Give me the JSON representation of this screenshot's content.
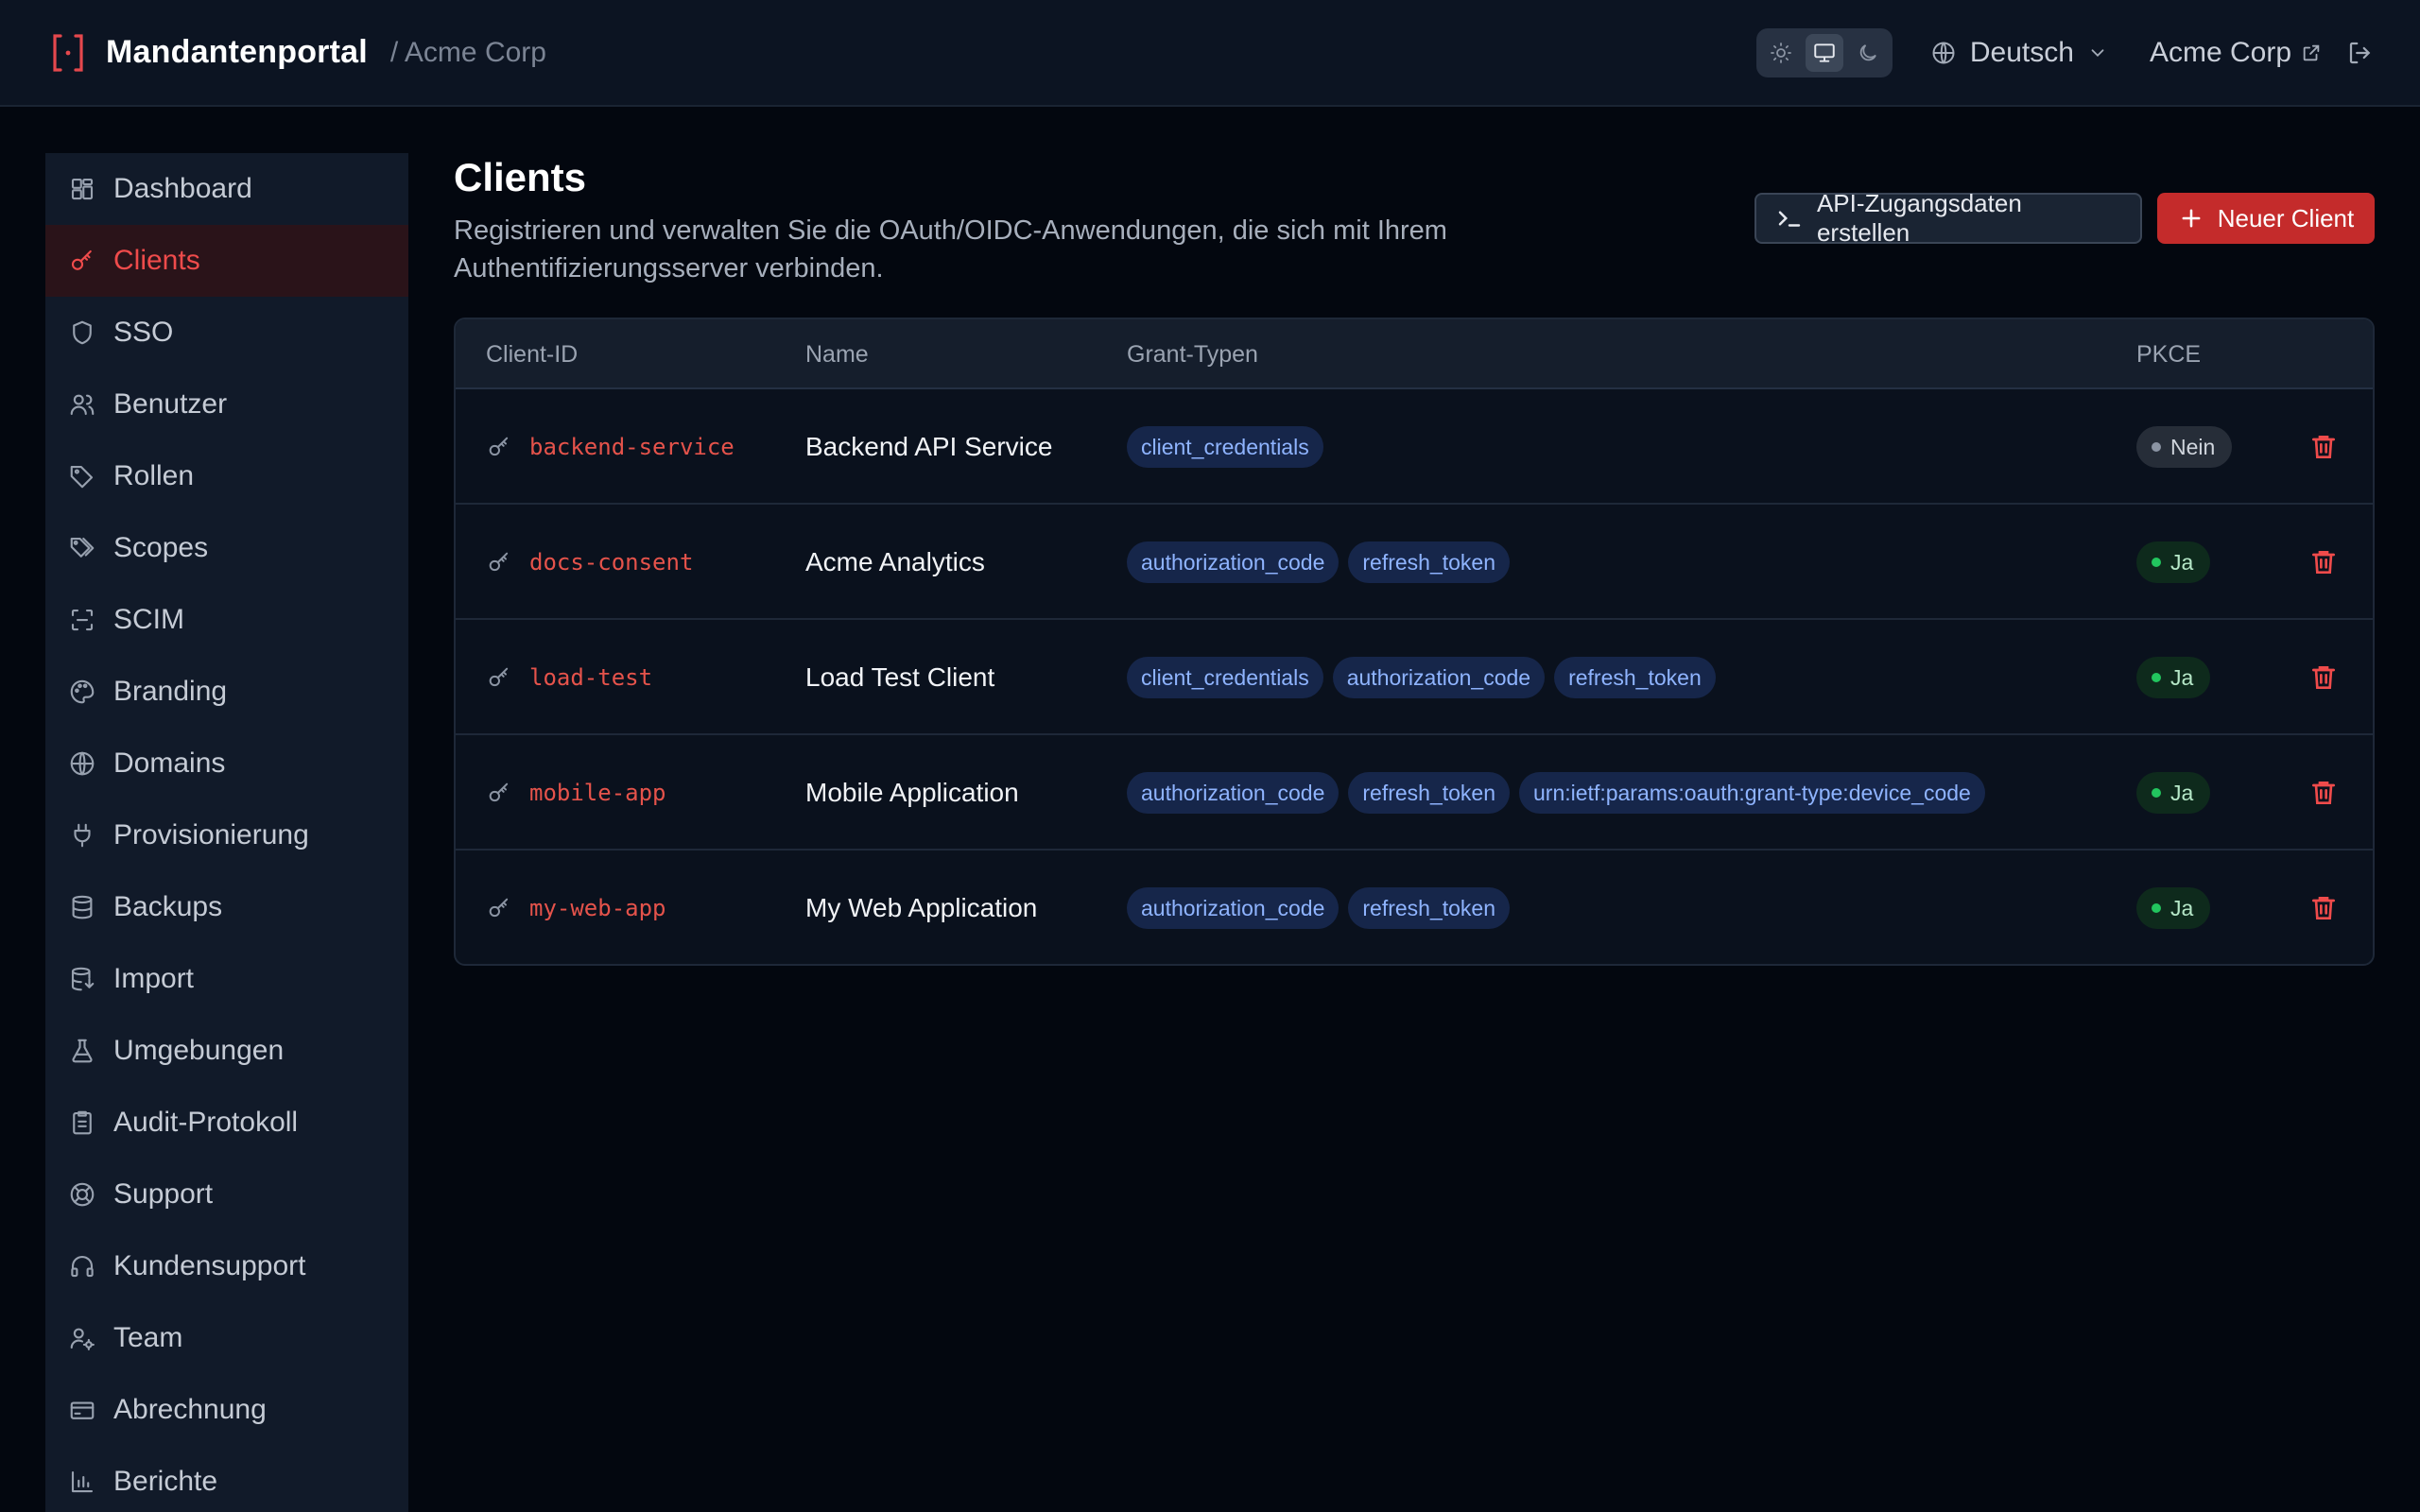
{
  "header": {
    "app_title": "Mandantenportal",
    "tenant_crumb": "/ Acme Corp",
    "language": "Deutsch",
    "tenant_link": "Acme Corp",
    "theme_active": "system"
  },
  "sidebar": {
    "items": [
      {
        "label": "Dashboard",
        "icon": "layout-dashboard-icon",
        "active": false
      },
      {
        "label": "Clients",
        "icon": "key-icon",
        "active": true
      },
      {
        "label": "SSO",
        "icon": "shield-icon",
        "active": false
      },
      {
        "label": "Benutzer",
        "icon": "users-icon",
        "active": false
      },
      {
        "label": "Rollen",
        "icon": "tag-icon",
        "active": false
      },
      {
        "label": "Scopes",
        "icon": "tags-icon",
        "active": false
      },
      {
        "label": "SCIM",
        "icon": "scan-icon",
        "active": false
      },
      {
        "label": "Branding",
        "icon": "palette-icon",
        "active": false
      },
      {
        "label": "Domains",
        "icon": "globe-icon",
        "active": false
      },
      {
        "label": "Provisionierung",
        "icon": "plug-icon",
        "active": false
      },
      {
        "label": "Backups",
        "icon": "database-icon",
        "active": false
      },
      {
        "label": "Import",
        "icon": "database-import-icon",
        "active": false
      },
      {
        "label": "Umgebungen",
        "icon": "flask-icon",
        "active": false
      },
      {
        "label": "Audit-Protokoll",
        "icon": "clipboard-icon",
        "active": false
      },
      {
        "label": "Support",
        "icon": "life-buoy-icon",
        "active": false
      },
      {
        "label": "Kundensupport",
        "icon": "headphones-icon",
        "active": false
      },
      {
        "label": "Team",
        "icon": "user-cog-icon",
        "active": false
      },
      {
        "label": "Abrechnung",
        "icon": "credit-card-icon",
        "active": false
      },
      {
        "label": "Berichte",
        "icon": "bar-chart-icon",
        "active": false
      }
    ]
  },
  "main": {
    "title": "Clients",
    "description": "Registrieren und verwalten Sie die OAuth/OIDC-Anwendungen, die sich mit Ihrem Authentifizierungsserver verbinden.",
    "api_button": "API-Zugangsdaten erstellen",
    "new_button": "Neuer Client"
  },
  "table": {
    "columns": [
      "Client-ID",
      "Name",
      "Grant-Typen",
      "PKCE"
    ],
    "rows": [
      {
        "client_id": "backend-service",
        "name": "Backend API Service",
        "grants": [
          "client_credentials"
        ],
        "pkce": "Nein",
        "pkce_enabled": false
      },
      {
        "client_id": "docs-consent",
        "name": "Acme Analytics",
        "grants": [
          "authorization_code",
          "refresh_token"
        ],
        "pkce": "Ja",
        "pkce_enabled": true
      },
      {
        "client_id": "load-test",
        "name": "Load Test Client",
        "grants": [
          "client_credentials",
          "authorization_code",
          "refresh_token"
        ],
        "pkce": "Ja",
        "pkce_enabled": true
      },
      {
        "client_id": "mobile-app",
        "name": "Mobile Application",
        "grants": [
          "authorization_code",
          "refresh_token",
          "urn:ietf:params:oauth:grant-type:device_code"
        ],
        "pkce": "Ja",
        "pkce_enabled": true
      },
      {
        "client_id": "my-web-app",
        "name": "My Web Application",
        "grants": [
          "authorization_code",
          "refresh_token"
        ],
        "pkce": "Ja",
        "pkce_enabled": true
      }
    ]
  },
  "colors": {
    "accent": "#ef4b4b",
    "chip_text": "#8fb4ff",
    "pkce_yes": "#22c55e",
    "background": "#03070f"
  }
}
